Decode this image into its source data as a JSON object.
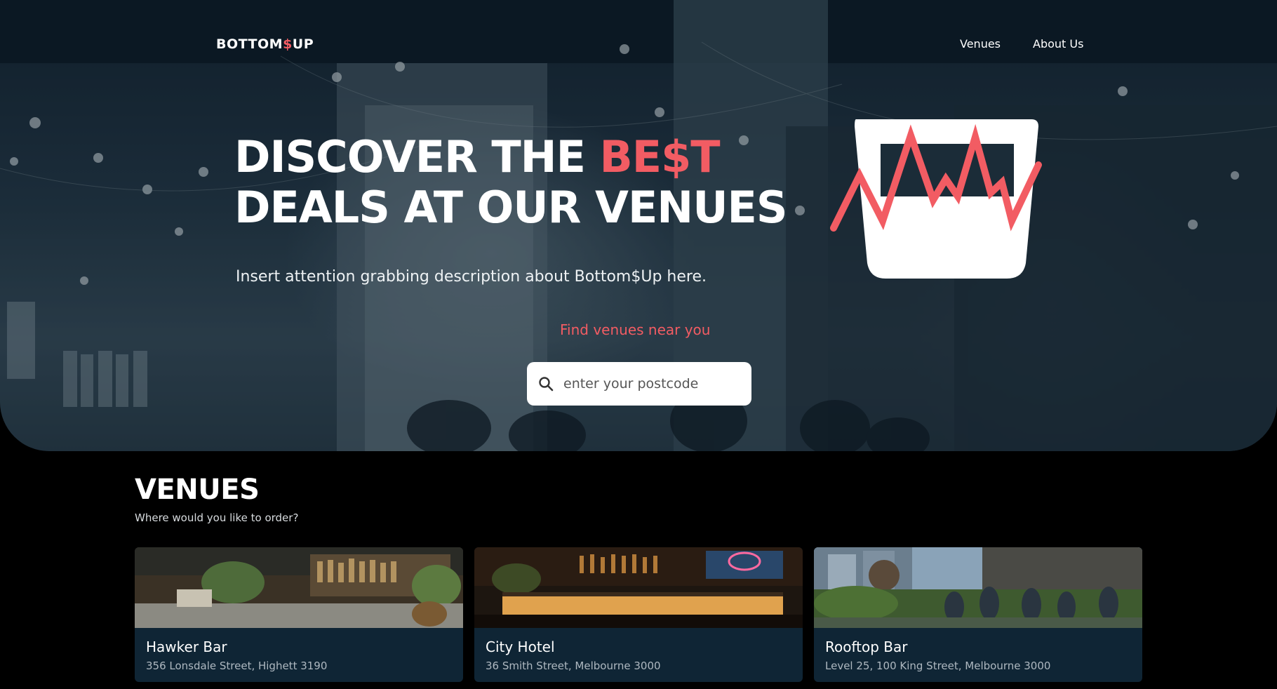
{
  "brand": {
    "logo_pre": "BOTTOM",
    "logo_dollar": "$",
    "logo_post": "UP"
  },
  "nav": {
    "items": [
      {
        "label": "Venues"
      },
      {
        "label": "About Us"
      }
    ]
  },
  "hero": {
    "headline_1": "DISCOVER THE ",
    "headline_accent": "BE$T",
    "headline_2": "DEALS AT OUR VENUES",
    "description": "Insert attention grabbing description about Bottom$Up here.",
    "find_link": "Find venues near you",
    "search_placeholder": "enter your postcode",
    "search_value": ""
  },
  "venues_section": {
    "title": "VENUES",
    "subtitle": "Where would you like to order?",
    "cards": [
      {
        "name": "Hawker Bar",
        "address": "356 Lonsdale Street, Highett 3190"
      },
      {
        "name": "City Hotel",
        "address": "36 Smith Street, Melbourne 3000"
      },
      {
        "name": "Rooftop Bar",
        "address": "Level 25, 100 King Street, Melbourne 3000"
      }
    ]
  },
  "colors": {
    "accent": "#f25c63",
    "card_bg": "#0f2535",
    "page_bg": "#000000"
  },
  "icons": {
    "search": "search-icon",
    "brand_mark": "glass-chart-logo-icon"
  }
}
